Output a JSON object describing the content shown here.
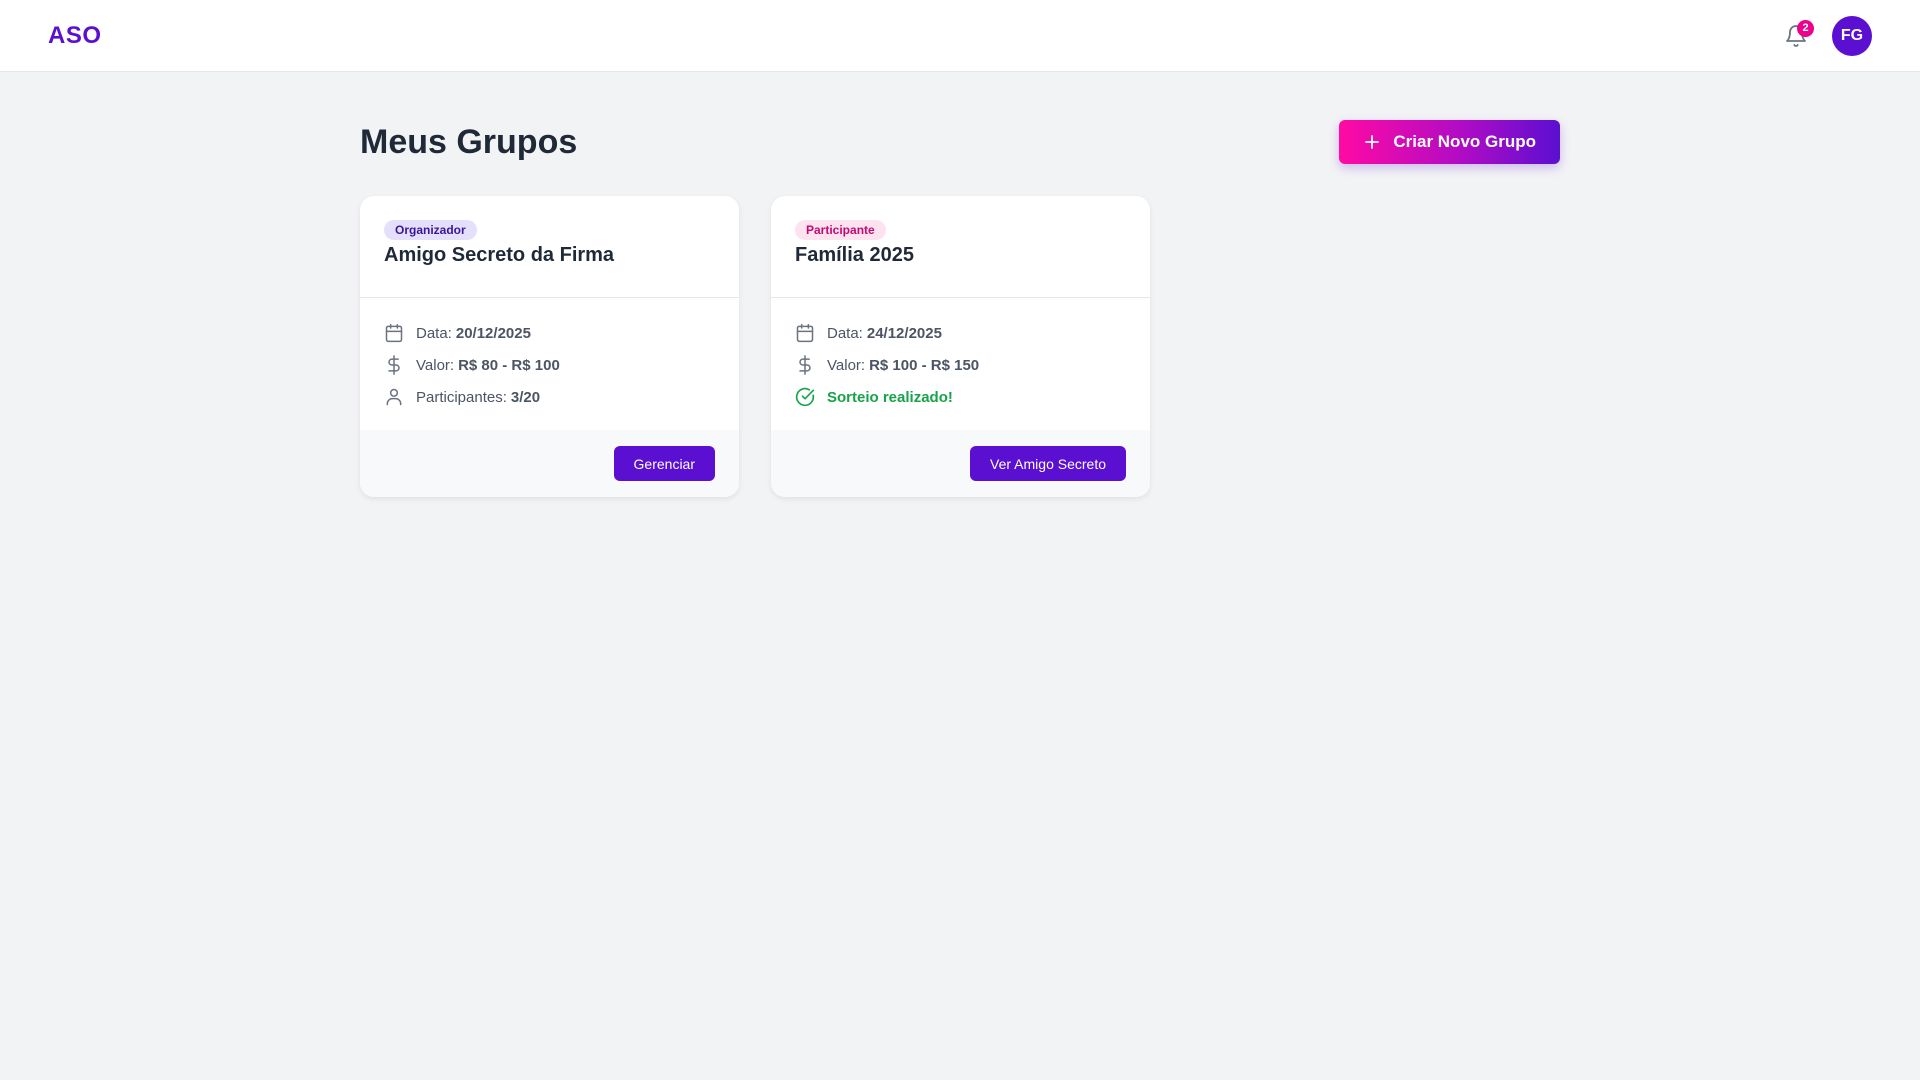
{
  "app": {
    "logo": "ASO",
    "notifications_count": "2",
    "user_initials": "FG"
  },
  "page": {
    "title": "Meus Grupos",
    "create_button_label": "Criar Novo Grupo"
  },
  "groups": [
    {
      "role": "Organizador",
      "name": "Amigo Secreto da Firma",
      "date_label": "Data:",
      "date": "20/12/2025",
      "value_label": "Valor:",
      "value": "R$ 80 - R$ 100",
      "participants_label": "Participantes:",
      "participants": "3/20",
      "action_label": "Gerenciar"
    },
    {
      "role": "Participante",
      "name": "Família 2025",
      "date_label": "Data:",
      "date": "24/12/2025",
      "value_label": "Valor:",
      "value": "R$ 100 - R$ 150",
      "status": "Sorteio realizado!",
      "action_label": "Ver Amigo Secreto"
    }
  ],
  "icons": {
    "bell": "bell-icon",
    "plus": "plus-icon",
    "calendar": "calendar-icon",
    "dollar": "dollar-icon",
    "user": "user-icon",
    "check_circle": "check-circle-icon"
  },
  "colors": {
    "brand": "#5b0fd1",
    "accent_pink": "#ec008c",
    "success": "#17a34a",
    "background": "#f2f3f5"
  }
}
